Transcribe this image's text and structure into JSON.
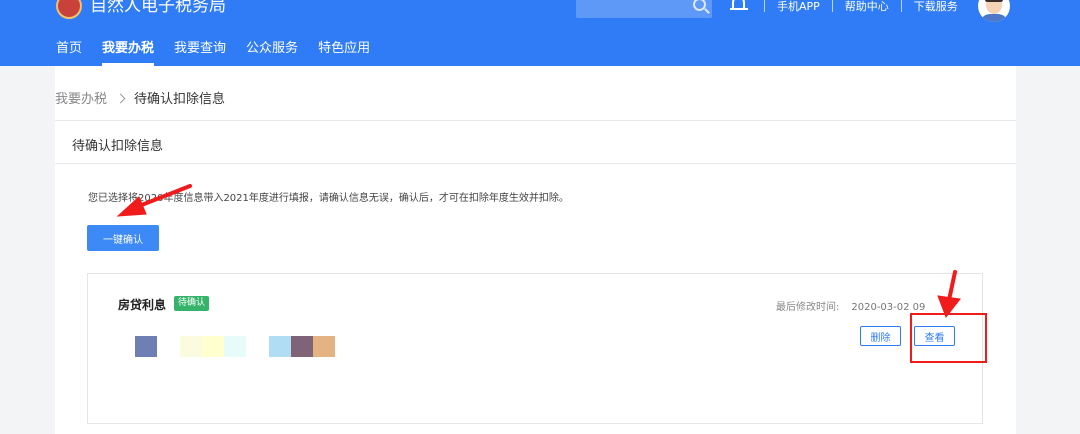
{
  "header": {
    "site_title": "自然人电子税务局",
    "top_links": [
      "手机APP",
      "帮助中心",
      "下载服务"
    ],
    "nav_items": [
      "首页",
      "我要办税",
      "我要查询",
      "公众服务",
      "特色应用"
    ],
    "active_nav_index": 1,
    "brand_color": "#2f7cf6"
  },
  "breadcrumb": {
    "parent": "我要办税",
    "current": "待确认扣除信息"
  },
  "panel": {
    "title": "待确认扣除信息",
    "notice": "您已选择将2020年度信息带入2021年度进行填报，请确认信息无误，确认后，才可在扣除年度生效并扣除。",
    "confirm_button": "一键确认"
  },
  "card": {
    "title": "房贷利息",
    "status": "待确认",
    "status_color": "#36b36b",
    "modified_label": "最后修改时间:",
    "modified_value": "2020-03-02 09",
    "delete_button": "删除",
    "view_button": "查看"
  },
  "annotations": {
    "arrow_color": "#f01b1b"
  },
  "icons": [
    "logo-icon",
    "search-icon",
    "bell-icon",
    "avatar",
    "chevron-right-icon",
    "red-arrow-icon"
  ]
}
